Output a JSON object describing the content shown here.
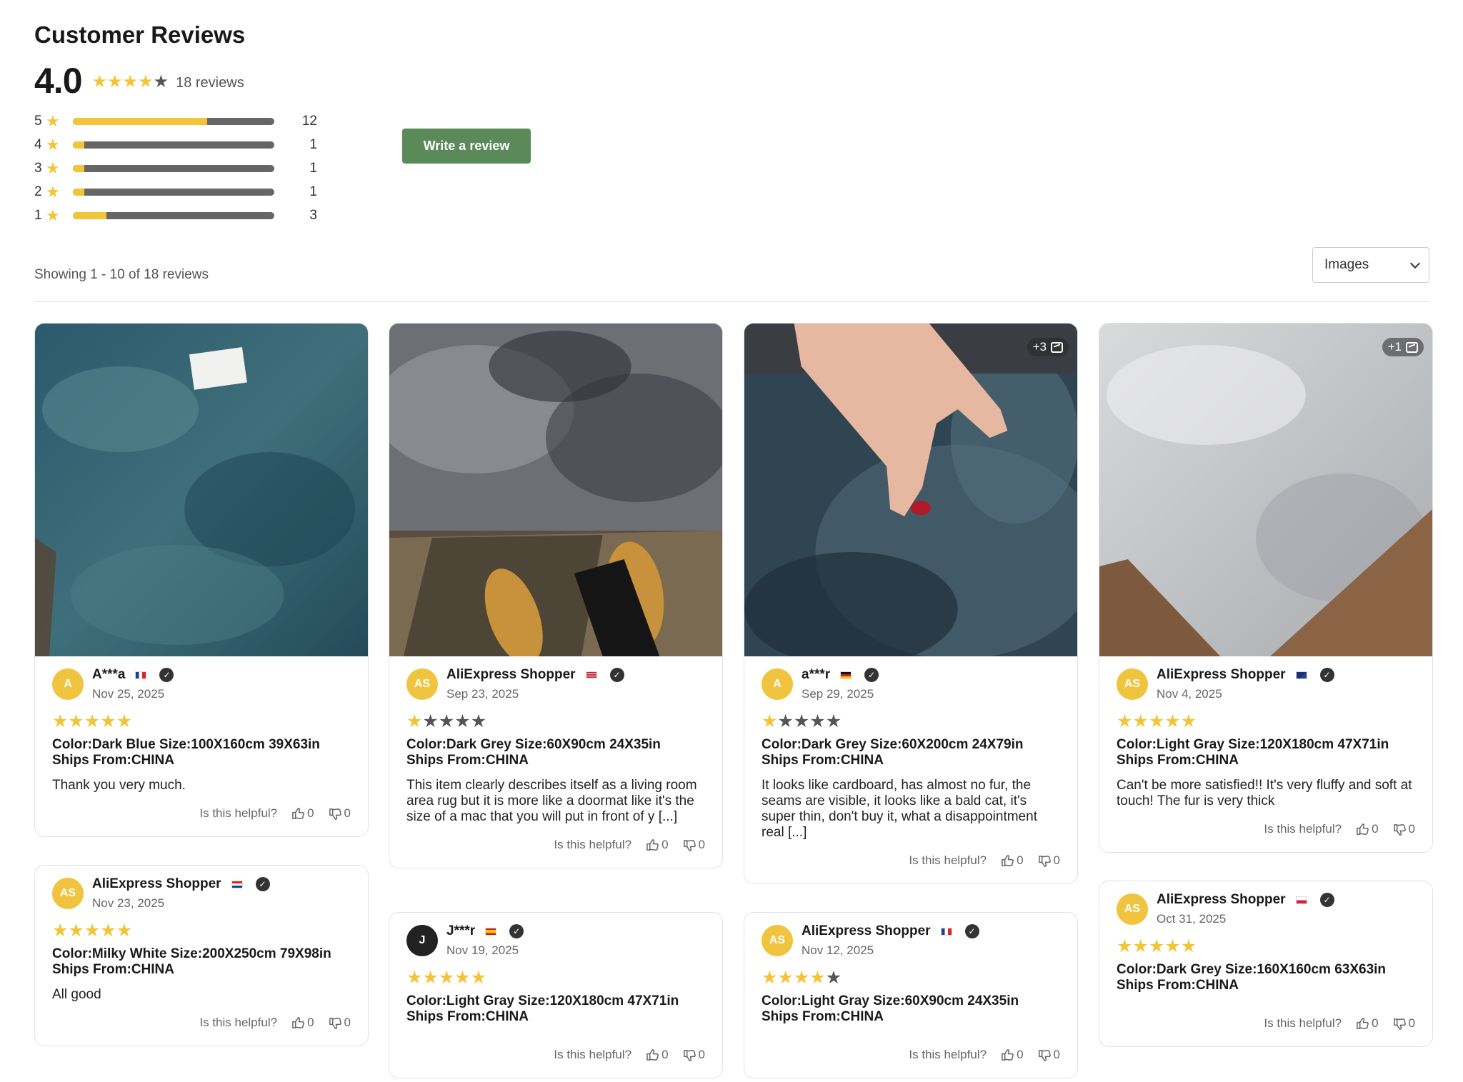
{
  "summary": {
    "title": "Customer Reviews",
    "average": "4.0",
    "average_value": 4.0,
    "count_label": "18 reviews",
    "distribution": [
      {
        "label": "5",
        "count": "12",
        "fraction": 0.667
      },
      {
        "label": "4",
        "count": "1",
        "fraction": 0.056
      },
      {
        "label": "3",
        "count": "1",
        "fraction": 0.056
      },
      {
        "label": "2",
        "count": "1",
        "fraction": 0.056
      },
      {
        "label": "1",
        "count": "3",
        "fraction": 0.167
      }
    ]
  },
  "write_review_label": "Write a review",
  "showing_label": "Showing 1 - 10 of 18 reviews",
  "filter": {
    "selected": "Images"
  },
  "helpful_label": "Is this helpful?",
  "colors": {
    "accent": "#5a8a57",
    "star": "#f2c537",
    "star_off": "#555555",
    "avatar": "#f0c43e"
  },
  "reviews": [
    {
      "initials": "A",
      "name": "A***a",
      "flag": "FR",
      "date": "Nov 25, 2025",
      "rating": 5,
      "spec1": "Color:Dark Blue Size:100X160cm 39X63in",
      "spec2": "Ships From:CHINA",
      "text": "Thank you very much.",
      "up": "0",
      "down": "0",
      "photo": "dark-blue-rug",
      "more": ""
    },
    {
      "initials": "AS",
      "name": "AliExpress Shopper",
      "flag": "US",
      "date": "Sep 23, 2025",
      "rating": 1,
      "spec1": "Color:Dark Grey Size:60X90cm 24X35in",
      "spec2": "Ships From:CHINA",
      "text": "This item clearly describes itself as a living room area rug but it is more like a doormat like it's the size of a mac that you will put in front of y [...]",
      "up": "0",
      "down": "0",
      "photo": "grey-rug-slippers",
      "more": ""
    },
    {
      "initials": "A",
      "name": "a***r",
      "flag": "DE",
      "date": "Sep 29, 2025",
      "rating": 1,
      "spec1": "Color:Dark Grey Size:60X200cm 24X79in",
      "spec2": "Ships From:CHINA",
      "text": "It looks like cardboard, has almost no fur, the seams are visible, it looks like a bald cat, it's super thin, don't buy it, what a disappointment real [...]",
      "up": "0",
      "down": "0",
      "photo": "hand-on-rug",
      "more": "+3"
    },
    {
      "initials": "AS",
      "name": "AliExpress Shopper",
      "flag": "AU",
      "date": "Nov 4, 2025",
      "rating": 5,
      "spec1": "Color:Light Gray Size:120X180cm 47X71in",
      "spec2": "Ships From:CHINA",
      "text": "Can't be more satisfied!! It's very fluffy and soft at touch! The fur is very thick",
      "up": "0",
      "down": "0",
      "photo": "light-gray-rug",
      "more": "+1"
    },
    {
      "initials": "AS",
      "name": "AliExpress Shopper",
      "flag": "HR",
      "date": "Nov 23, 2025",
      "rating": 5,
      "spec1": "Color:Milky White Size:200X250cm 79X98in",
      "spec2": "Ships From:CHINA",
      "text": "All good",
      "up": "0",
      "down": "0"
    },
    {
      "initials": "J",
      "name": "J***r",
      "flag": "ES",
      "date": "Nov 19, 2025",
      "rating": 5,
      "spec1": "Color:Light Gray Size:120X180cm 47X71in",
      "spec2": "Ships From:CHINA",
      "text": "",
      "up": "0",
      "down": "0"
    },
    {
      "initials": "AS",
      "name": "AliExpress Shopper",
      "flag": "FR",
      "date": "Nov 12, 2025",
      "rating": 4,
      "spec1": "Color:Light Gray Size:60X90cm 24X35in",
      "spec2": "Ships From:CHINA",
      "text": "",
      "up": "0",
      "down": "0"
    },
    {
      "initials": "AS",
      "name": "AliExpress Shopper",
      "flag": "PL",
      "date": "Oct 31, 2025",
      "rating": 5,
      "spec1": "Color:Dark Grey Size:160X160cm 63X63in",
      "spec2": "Ships From:CHINA",
      "text": "",
      "up": "0",
      "down": "0"
    }
  ]
}
